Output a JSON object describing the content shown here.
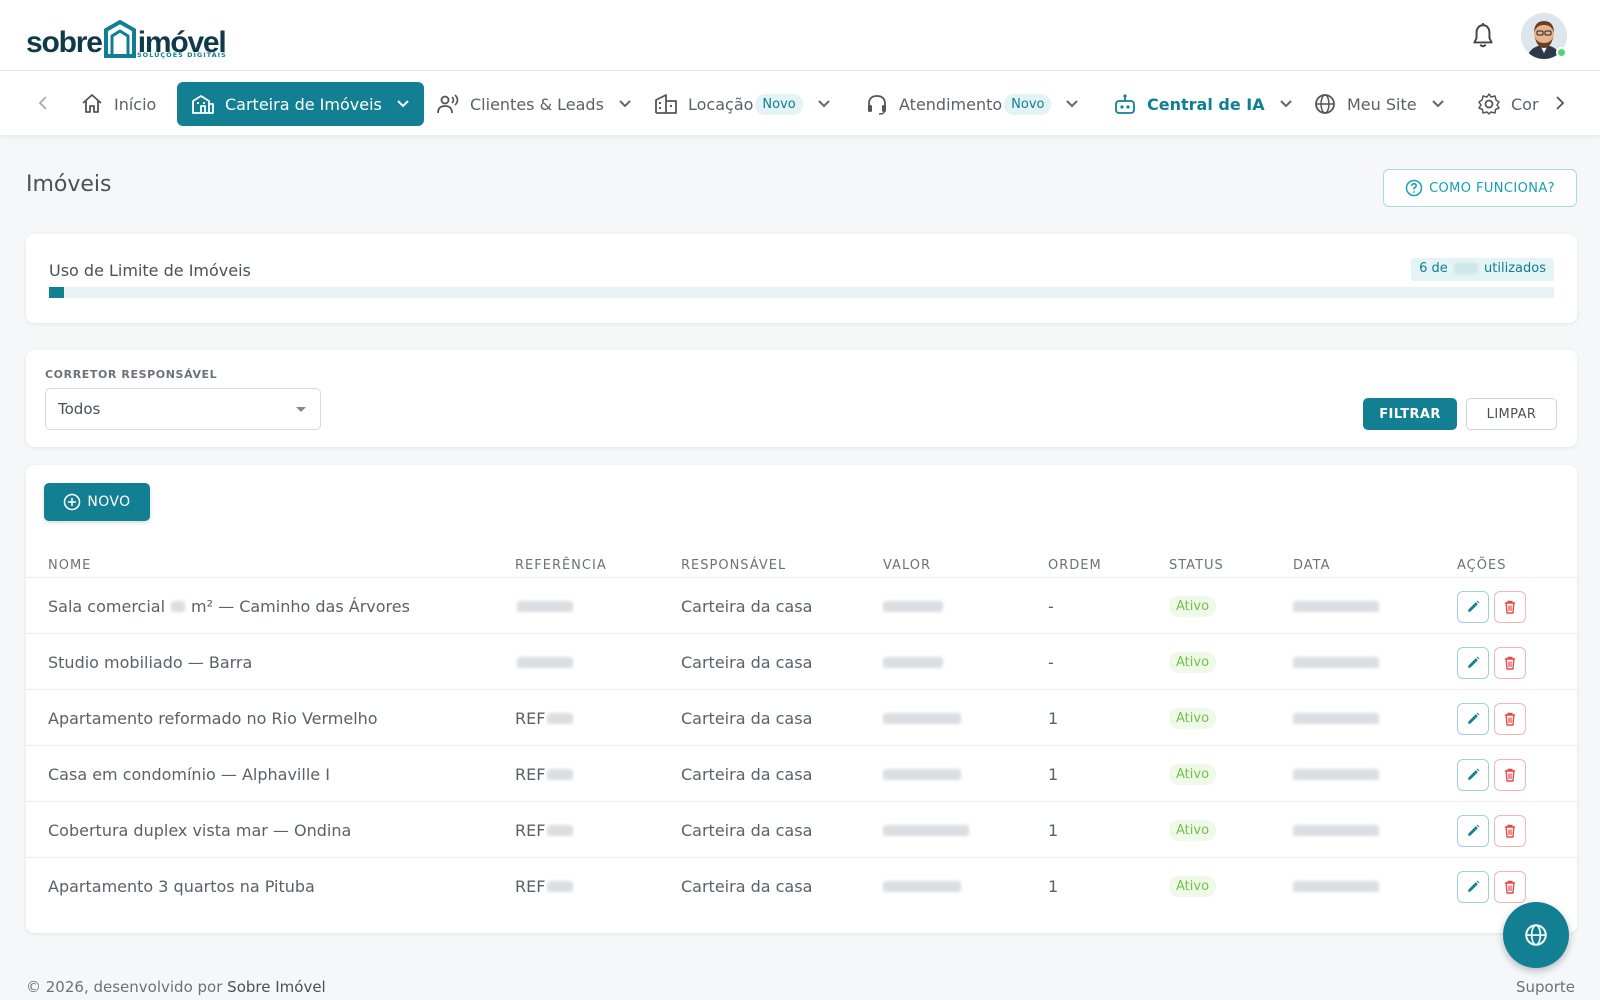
{
  "brand": {
    "word1": "sobre",
    "word2": "imóvel",
    "tagline": "SOLUÇÕES DIGITAIS",
    "accent": "#127f93",
    "dark": "#103a4a"
  },
  "nav": {
    "items": [
      {
        "label": "Início",
        "icon": "home-icon"
      },
      {
        "label": "Carteira de Imóveis",
        "icon": "building-icon"
      },
      {
        "label": "Clientes & Leads",
        "icon": "users-icon"
      },
      {
        "label": "Locação",
        "icon": "buildings-icon",
        "badge": "Novo"
      },
      {
        "label": "Atendimento",
        "icon": "headset-icon",
        "badge": "Novo"
      },
      {
        "label": "Central de IA",
        "icon": "robot-icon"
      },
      {
        "label": "Meu Site",
        "icon": "globe-icon"
      },
      {
        "label": "Cor",
        "icon": "gear-icon"
      }
    ]
  },
  "page": {
    "title": "Imóveis",
    "help_button": "COMO FUNCIONA?"
  },
  "usage": {
    "title": "Uso de Limite de Imóveis",
    "used_prefix": "6 de",
    "used_suffix": "utilizados",
    "used": 6,
    "fill_percent": 1
  },
  "filter": {
    "label": "CORRETOR RESPONSÁVEL",
    "selected": "Todos",
    "filter_button": "FILTRAR",
    "clear_button": "LIMPAR"
  },
  "table": {
    "new_button": "NOVO",
    "headers": [
      "NOME",
      "REFERÊNCIA",
      "RESPONSÁVEL",
      "VALOR",
      "ORDEM",
      "STATUS",
      "DATA",
      "AÇÕES"
    ],
    "rows": [
      {
        "name_a": "Sala comercial",
        "name_b": "m² — Caminho das Árvores",
        "ref_prefix": "",
        "responsible": "Carteira da casa",
        "order": "-",
        "status": "Ativo"
      },
      {
        "name_a": "Studio mobiliado — Barra",
        "name_b": "",
        "ref_prefix": "",
        "responsible": "Carteira da casa",
        "order": "-",
        "status": "Ativo"
      },
      {
        "name_a": "Apartamento reformado no Rio Vermelho",
        "name_b": "",
        "ref_prefix": "REF",
        "responsible": "Carteira da casa",
        "order": "1",
        "status": "Ativo"
      },
      {
        "name_a": "Casa em condomínio — Alphaville I",
        "name_b": "",
        "ref_prefix": "REF",
        "responsible": "Carteira da casa",
        "order": "1",
        "status": "Ativo"
      },
      {
        "name_a": "Cobertura duplex vista mar — Ondina",
        "name_b": "",
        "ref_prefix": "REF",
        "responsible": "Carteira da casa",
        "order": "1",
        "status": "Ativo"
      },
      {
        "name_a": "Apartamento 3 quartos na Pituba",
        "name_b": "",
        "ref_prefix": "REF",
        "responsible": "Carteira da casa",
        "order": "1",
        "status": "Ativo"
      }
    ]
  },
  "footer": {
    "text": "© 2026, desenvolvido por",
    "brand": "Sobre Imóvel",
    "support": "Suporte"
  }
}
